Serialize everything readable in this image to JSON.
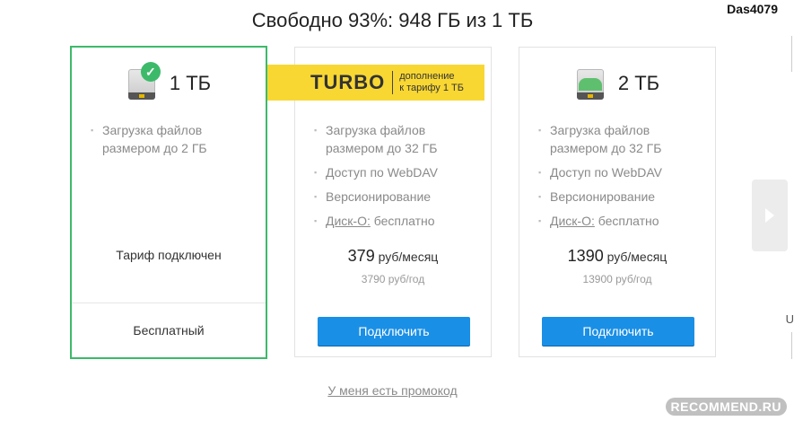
{
  "header": {
    "title": "Свободно 93%: 948 ГБ из 1 ТБ",
    "user": "Das4079"
  },
  "plans": [
    {
      "size": "1 ТБ",
      "features": [
        "Загрузка файлов размером до 2 ГБ"
      ],
      "status": "Тариф подключен",
      "footer": "Бесплатный",
      "active": true
    },
    {
      "features": [
        "Загрузка файлов размером до 32 ГБ",
        "Доступ по WebDAV",
        "Версионирование"
      ],
      "feature_link": "Диск-О:",
      "feature_link_rest": " бесплатно",
      "price_num": "379",
      "price_unit": " руб/месяц",
      "price_year": "3790 руб/год",
      "button": "Подключить"
    },
    {
      "size": "2 ТБ",
      "features": [
        "Загрузка файлов размером до 32 ГБ",
        "Доступ по WebDAV",
        "Версионирование"
      ],
      "feature_link": "Диск-О:",
      "feature_link_rest": " бесплатно",
      "price_num": "1390",
      "price_unit": " руб/месяц",
      "price_year": "13900 руб/год",
      "button": "Подключить"
    }
  ],
  "turbo": {
    "word": "TURBO",
    "sub1": "дополнение",
    "sub2": "к тарифу 1 ТБ"
  },
  "promo": "У меня есть промокод",
  "cut_letter": "U",
  "watermark": "RECOMMEND.RU",
  "colors": {
    "accent_green": "#3cba6a",
    "button_blue": "#1a8fe6",
    "turbo_yellow": "#f8d733"
  },
  "icons": {
    "disk": "disk-icon",
    "check": "check-icon",
    "next": "arrow-right-icon"
  }
}
